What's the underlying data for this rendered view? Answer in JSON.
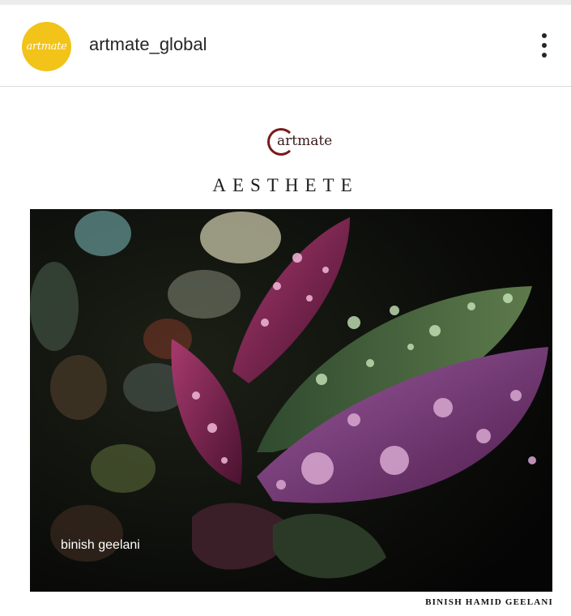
{
  "header": {
    "avatar_text": "artmate",
    "username": "artmate_global",
    "more_icon": "more-vertical-icon"
  },
  "post": {
    "brand_logo_text": "artmate",
    "title": "AESTHETE",
    "photo_caption": "binish geelani",
    "credit": "BINISH HAMID GEELANI"
  },
  "colors": {
    "avatar_bg": "#f2c318",
    "text_primary": "#262626",
    "brand_ring": "#7a1a1a"
  }
}
